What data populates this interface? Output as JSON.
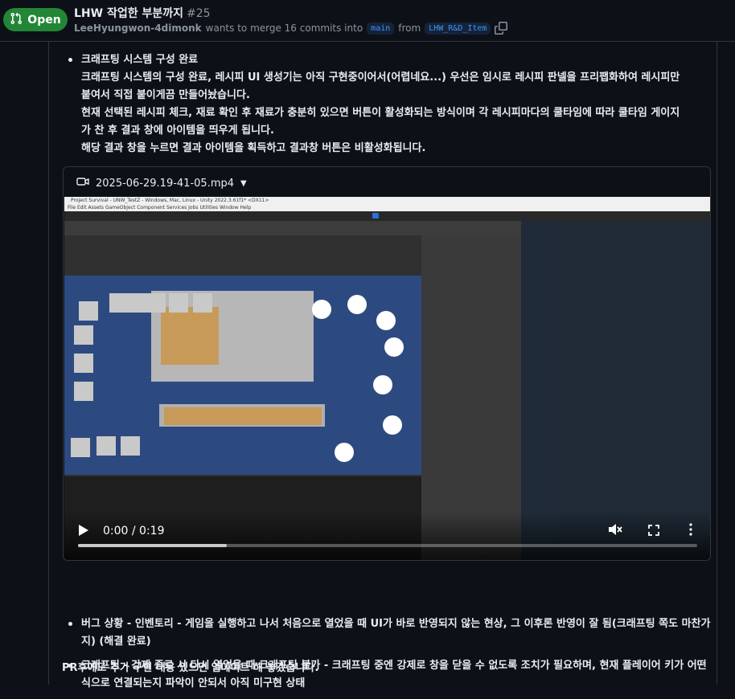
{
  "header": {
    "state_label": "Open",
    "title": "LHW 작업한 부분까지",
    "number": "#25",
    "author": "LeeHyungwon-4dimonk",
    "merge_text": "wants to merge 16 commits into",
    "base_branch": "main",
    "from_text": "from",
    "head_branch": "LHW_R&D_Item",
    "colors": {
      "open_badge": "#238636",
      "branch": "#4493f8"
    },
    "icons": [
      "git-pull-request-icon",
      "copy-icon"
    ]
  },
  "intro_item": {
    "title": "크래프팅 시스템 구성 완료",
    "lines": [
      "크래프팅 시스템의 구성 완료, 레시피 UI 생성기는 아직 구현중이어서(어렵네요...) 우선은 임시로 레시피 판넬을 프리팹화하여 레시피만",
      "붙여서 직접 붙이게끔 만들어놨습니다.",
      "현재 선택된 레시피 체크, 재료 확인 후 재료가 충분히 있으면 버튼이 활성화되는 방식이며 각 레시피마다의 쿨타임에 따라 쿨타임 게이지",
      "가 찬 후 결과 창에 아이템을 띄우게 됩니다.",
      "해당 결과 창을 누르면 결과 아이템을 획득하고 결과창 버튼은 비활성화됩니다."
    ]
  },
  "video": {
    "filename": "2025-06-29.19-41-05.mp4",
    "time": "0:00 / 0:19",
    "progress": 0.24,
    "icons": [
      "video-icon",
      "play-icon",
      "mute-icon",
      "fullscreen-icon",
      "more-icon"
    ],
    "frame": {
      "window_title": "Project Survival - UNW_TestZ - Windows, Mac, Linux - Unity 2022.3.61f1* <DX11>",
      "menu": "File   Edit   Assets   GameObject   Component   Services   Jobs   Utilities   Window   Help"
    }
  },
  "later_items": [
    "버그 상황 - 인벤토리 - 게임을 실행하고 나서 처음으로 열었을 때 UI가 바로 반영되지 않는 현상, 그 이후론 반영이 잘 됨(크래프팅 쪽도 마찬가지) (해결 완료)",
    "크래프팅 - 강제 종료 시 다시 열었을 때 크래프팅 불가 - 크래프팅 중엔 강제로 창을 닫을 수 없도록 조치가 필요하며, 현재 플레이어 키가 어떤 식으로 연결되는지 파악이 안되서 아직 미구현 상태"
  ],
  "footer": "PR후에도 추가 구현 내용 있으면 업데이트 해 놓겠습니다."
}
